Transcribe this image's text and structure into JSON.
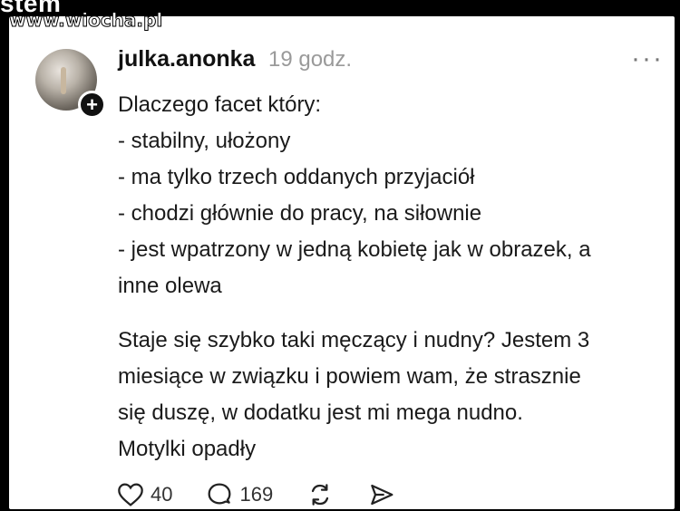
{
  "overlay": {
    "top_text": "stem",
    "watermark": "www.wiocha.pl"
  },
  "post": {
    "username": "julka.anonka",
    "time": "19 godz.",
    "more_icon": "more-horizontal-icon",
    "lines": [
      "Dlaczego facet który:",
      "- stabilny, ułożony",
      "- ma tylko trzech oddanych przyjaciół",
      "- chodzi głównie do pracy, na siłownie",
      "- jest wpatrzony w jedną kobietę jak w obrazek, a",
      "inne olewa"
    ],
    "lines2": [
      "Staje się szybko taki męczący i nudny? Jestem 3",
      "miesiące w związku i powiem wam, że strasznie",
      "się duszę, w dodatku jest mi mega nudno.",
      "Motylki opadły"
    ]
  },
  "actions": {
    "likes": "40",
    "comments": "169"
  }
}
